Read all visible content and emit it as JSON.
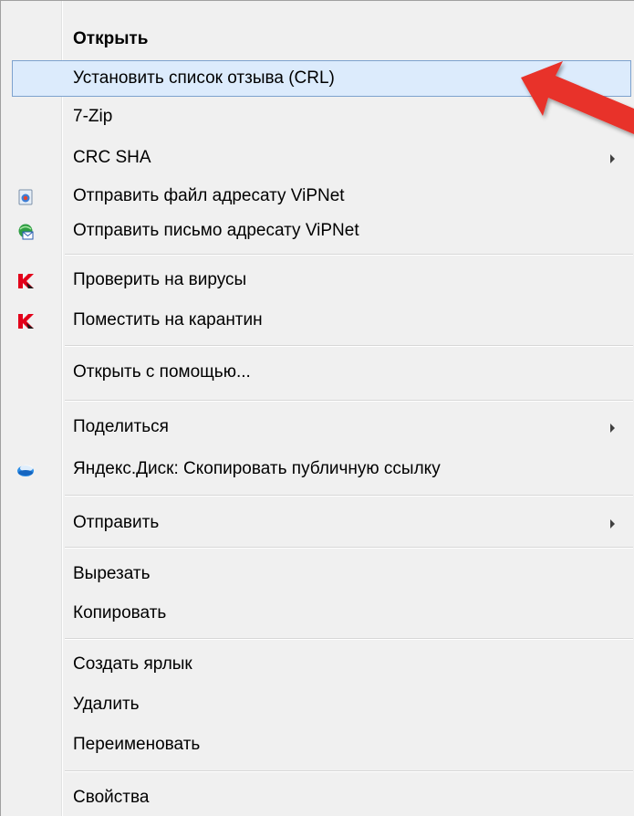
{
  "menu": {
    "items": [
      {
        "label": "Открыть",
        "bold": true
      },
      {
        "label": "Установить список отзыва (CRL)",
        "highlighted": true
      },
      {
        "label": "7-Zip"
      },
      {
        "label": "CRC SHA",
        "submenu": true
      },
      {
        "label": "Отправить файл адресату ViPNet",
        "icon": "vipnet-file-icon"
      },
      {
        "label": "Отправить письмо адресату ViPNet",
        "icon": "vipnet-mail-icon"
      },
      {
        "label": "Проверить на вирусы",
        "icon": "kaspersky-icon"
      },
      {
        "label": "Поместить на карантин",
        "icon": "kaspersky-icon"
      },
      {
        "label": "Открыть с помощью..."
      },
      {
        "label": "Поделиться",
        "submenu": true
      },
      {
        "label": "Яндекс.Диск: Скопировать публичную ссылку",
        "icon": "yandex-disk-icon"
      },
      {
        "label": "Отправить",
        "submenu": true
      },
      {
        "label": "Вырезать"
      },
      {
        "label": "Копировать"
      },
      {
        "label": "Создать ярлык"
      },
      {
        "label": "Удалить"
      },
      {
        "label": "Переименовать"
      },
      {
        "label": "Свойства"
      }
    ]
  },
  "colors": {
    "menu_background": "#f0f0f0",
    "highlight_background": "#dcebfc",
    "highlight_border": "#7da2ce",
    "annotation_arrow": "#e8312a"
  }
}
